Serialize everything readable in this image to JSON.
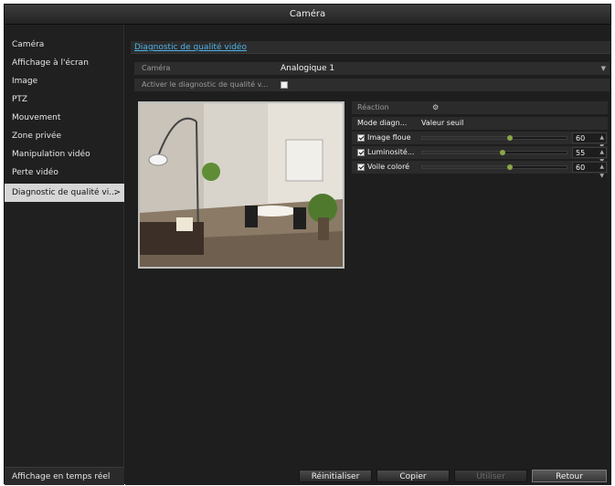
{
  "window": {
    "title": "Caméra"
  },
  "sidebar": {
    "items": [
      {
        "label": "Caméra"
      },
      {
        "label": "Affichage à l'écran"
      },
      {
        "label": "Image"
      },
      {
        "label": "PTZ"
      },
      {
        "label": "Mouvement"
      },
      {
        "label": "Zone privée"
      },
      {
        "label": "Manipulation vidéo"
      },
      {
        "label": "Perte vidéo"
      },
      {
        "label": "Diagnostic de qualité vi...",
        "arrow": ">"
      }
    ],
    "active_index": 8,
    "bottom_label": "Affichage en temps réel"
  },
  "main": {
    "tab_label": "Diagnostic de qualité vidéo",
    "camera_label": "Caméra",
    "camera_value": "Analogique 1",
    "enable_label": "Activer le diagnostic de qualité v...",
    "enable_checked": false
  },
  "panel": {
    "reaction_label": "Réaction",
    "mode_label": "Mode diagn...",
    "mode_value": "Valeur seuil",
    "settings": [
      {
        "label": "Image floue",
        "checked": true,
        "value": "60",
        "fraction": 0.6
      },
      {
        "label": "Luminosité...",
        "checked": true,
        "value": "55",
        "fraction": 0.55
      },
      {
        "label": "Voile coloré",
        "checked": true,
        "value": "60",
        "fraction": 0.6
      }
    ]
  },
  "buttons": {
    "reset": "Réinitialiser",
    "copy": "Copier",
    "apply": "Utiliser",
    "back": "Retour"
  },
  "colors": {
    "accent_link": "#4fb2e8",
    "slider_knob": "#8aa64a"
  }
}
